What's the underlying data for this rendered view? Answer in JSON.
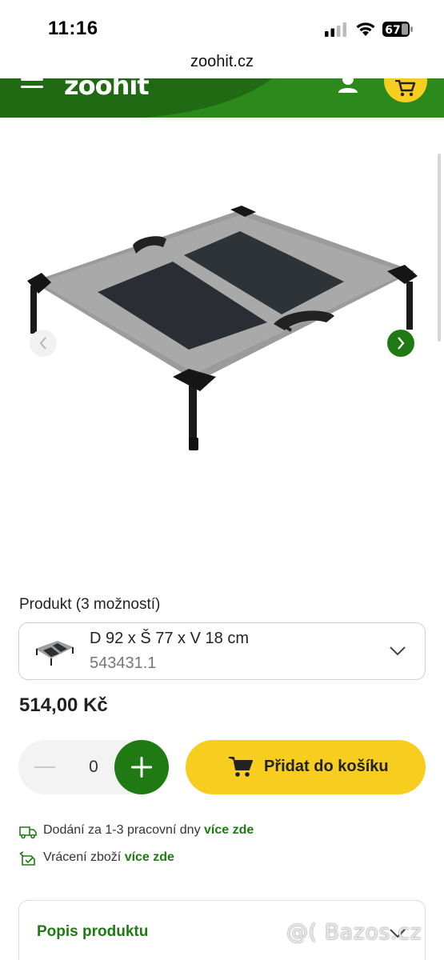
{
  "status_bar": {
    "time": "11:16",
    "battery_level": "67",
    "icons": [
      "signal-icon",
      "wifi-icon",
      "battery-icon"
    ]
  },
  "browser": {
    "url": "zoohit.cz"
  },
  "header": {
    "logo": "zoohit",
    "background_color": "#1f6a12",
    "accent_color": "#f7cd1f",
    "icons": [
      "menu-icon",
      "user-icon",
      "cart-icon"
    ]
  },
  "gallery": {
    "icons": [
      "chevron-left-icon",
      "chevron-right-icon"
    ]
  },
  "product": {
    "variant_label": "Produkt (3 možností)",
    "selected_variant": {
      "name": "D 92 x Š 77 x V 18 cm",
      "code": "543431.1"
    },
    "price": "514,00 Kč",
    "quantity": "0",
    "add_to_cart_label": "Přidat do košíku"
  },
  "info": {
    "delivery_text": "Dodání za 1-3 pracovní dny ",
    "delivery_link": "více zde",
    "return_text": "Vrácení zboží ",
    "return_link": "více zde"
  },
  "description": {
    "title": "Popis produktu"
  },
  "watermark": "@( Bazos.cz"
}
